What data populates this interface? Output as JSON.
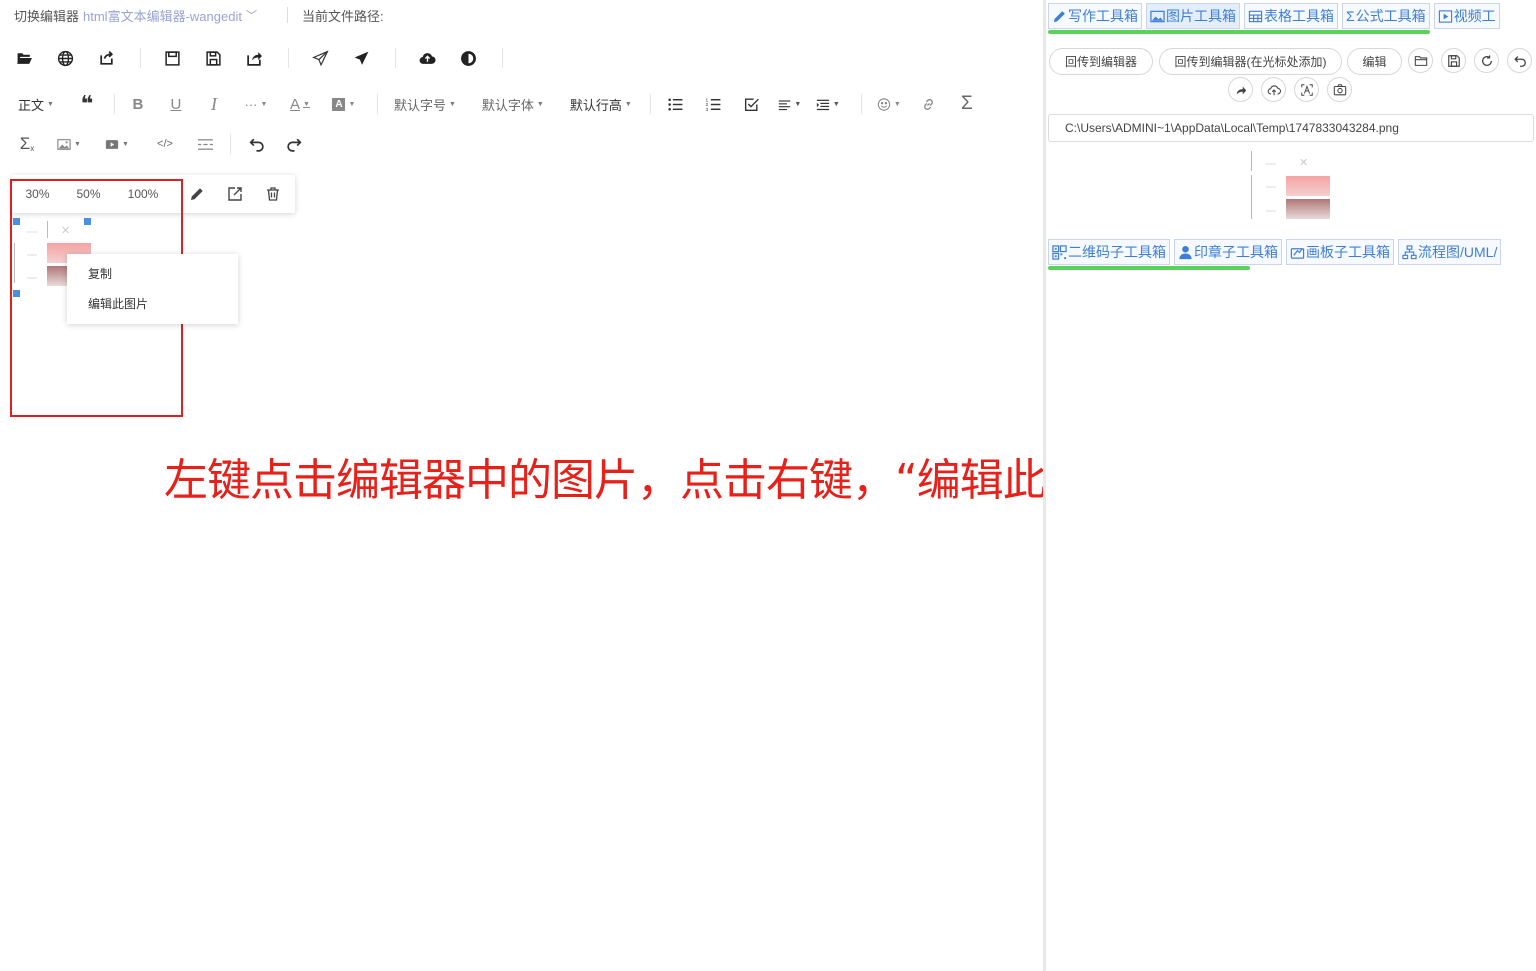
{
  "topbar": {
    "switch_label": "切换编辑器",
    "editor_name": "html富文本编辑器-wangedit",
    "path_label": "当前文件路径:"
  },
  "toolbar": {
    "paragraph": "正文",
    "font_size": "默认字号",
    "font_family": "默认字体",
    "line_height": "默认行高"
  },
  "image_popover": {
    "pct_30": "30%",
    "pct_50": "50%",
    "pct_100": "100%"
  },
  "context_menu": {
    "copy": "复制",
    "edit_image": "编辑此图片"
  },
  "annotation": "左键点击编辑器中的图片，点击右键，“编辑此图片”，进行图片创作",
  "right": {
    "tabs": [
      "写作工具箱",
      "图片工具箱",
      "表格工具箱",
      "公式工具箱",
      "视频工"
    ],
    "send_back": "回传到编辑器",
    "send_back_cursor": "回传到编辑器(在光标处添加)",
    "edit": "编辑",
    "file_path": "C:\\Users\\ADMINI~1\\AppData\\Local\\Temp\\1747833043284.png",
    "subtabs": [
      "二维码子工具箱",
      "印章子工具箱",
      "画板子工具箱",
      "流程图/UML/"
    ]
  },
  "colors": {
    "accent": "#3d7fd6",
    "annotation": "#e8201a",
    "highlight_bar": "#5ad35a",
    "selection_handle": "#4a90e2"
  }
}
